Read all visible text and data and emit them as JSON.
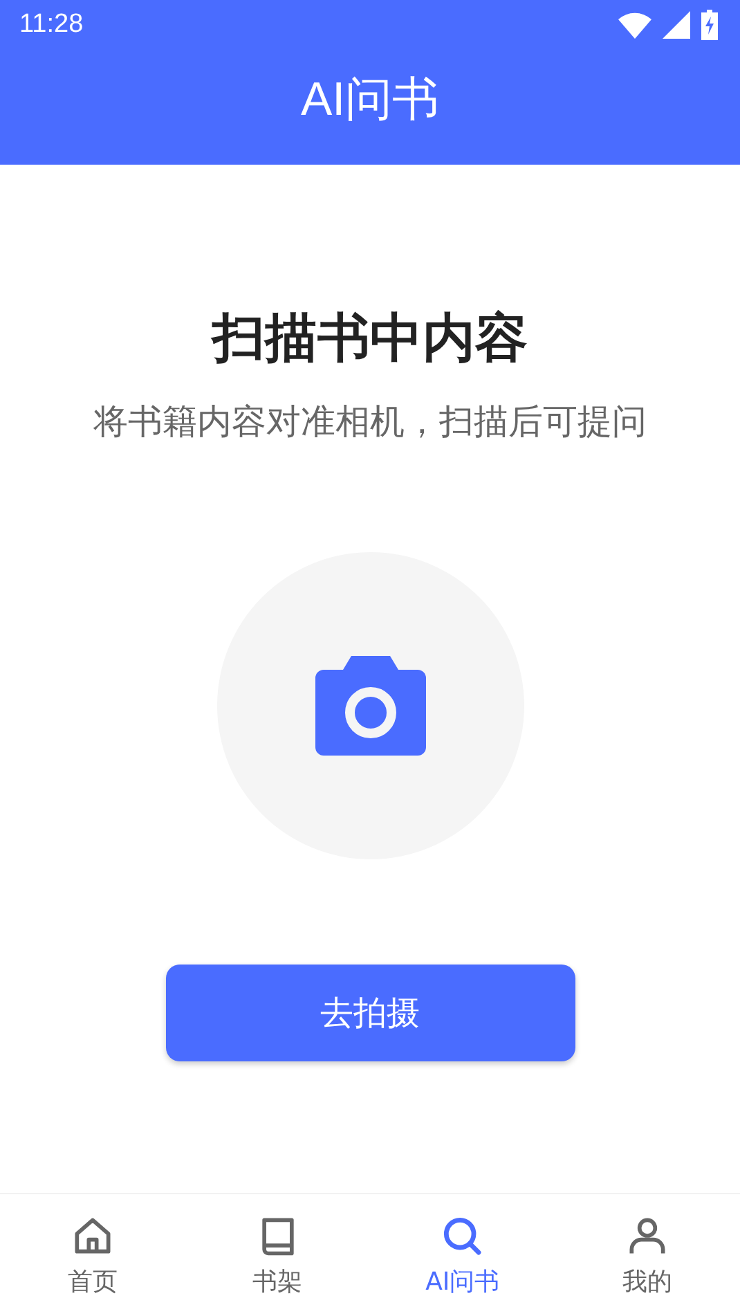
{
  "status_bar": {
    "time": "11:28"
  },
  "header": {
    "title": "AI问书"
  },
  "scan": {
    "title": "扫描书中内容",
    "subtitle": "将书籍内容对准相机，扫描后可提问",
    "button": "去拍摄"
  },
  "tabs": [
    {
      "kind": "home",
      "label": "首页",
      "selected": false
    },
    {
      "kind": "book",
      "label": "书架",
      "selected": false
    },
    {
      "kind": "search",
      "label": "AI问书",
      "selected": true
    },
    {
      "kind": "person",
      "label": "我的",
      "selected": false
    }
  ]
}
